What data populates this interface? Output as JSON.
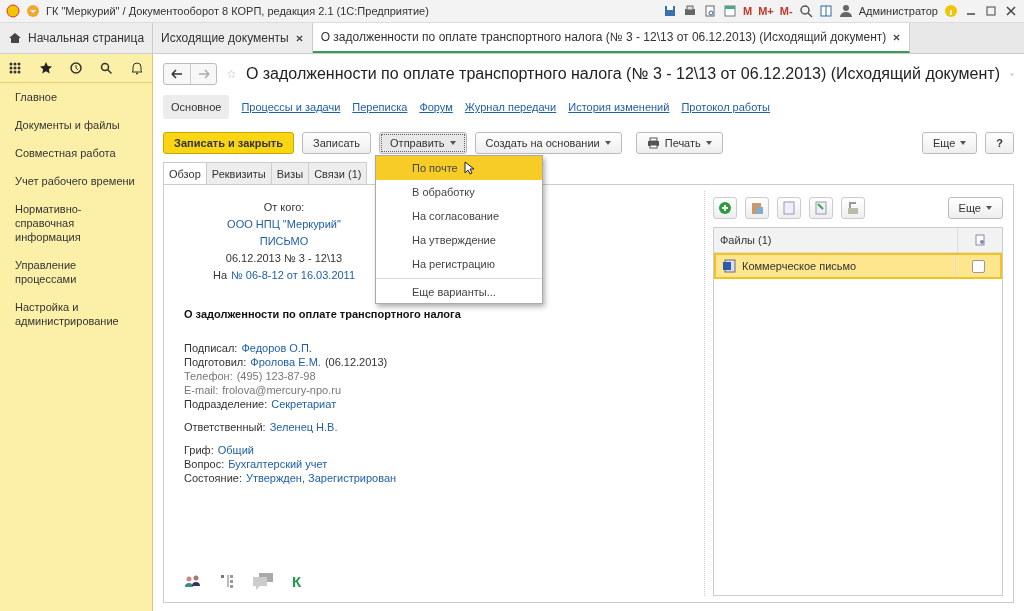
{
  "window": {
    "title": "ГК \"Меркурий\" / Документооборот 8 КОРП, редакция 2.1  (1С:Предприятие)",
    "user": "Администратор",
    "memory_buttons": [
      "M",
      "M+",
      "M-"
    ]
  },
  "tabs": [
    {
      "label": "Начальная страница",
      "selected": false,
      "closable": false
    },
    {
      "label": "Исходящие документы",
      "selected": false,
      "closable": true
    },
    {
      "label": "О задолженности по оплате транспортного налога (№ 3 - 12\\13 от 06.12.2013) (Исходящий документ)",
      "selected": true,
      "closable": true
    }
  ],
  "sidebar": {
    "items": [
      {
        "label": "Главное"
      },
      {
        "label": "Документы и файлы"
      },
      {
        "label": "Совместная работа"
      },
      {
        "label": "Учет рабочего времени"
      },
      {
        "label": "Нормативно-справочная информация"
      },
      {
        "label": "Управление процессами"
      },
      {
        "label": "Настройка и администрирование"
      }
    ]
  },
  "document": {
    "title": "О задолженности по оплате транспортного налога (№ 3 - 12\\13 от 06.12.2013) (Исходящий документ)",
    "nav_links": [
      {
        "label": "Основное",
        "selected": true
      },
      {
        "label": "Процессы и задачи",
        "selected": false
      },
      {
        "label": "Переписка",
        "selected": false
      },
      {
        "label": "Форум",
        "selected": false
      },
      {
        "label": "Журнал передачи",
        "selected": false
      },
      {
        "label": "История изменений",
        "selected": false
      },
      {
        "label": "Протокол работы",
        "selected": false
      }
    ],
    "buttons": [
      {
        "label": "Записать и закрыть",
        "kind": "primary"
      },
      {
        "label": "Записать",
        "kind": "plain"
      },
      {
        "label": "Отправить",
        "kind": "menu",
        "open": true
      },
      {
        "label": "Создать на основании",
        "kind": "menu",
        "open": false
      },
      {
        "label": "Печать",
        "kind": "print",
        "open": false
      }
    ],
    "more_button": "Еще",
    "help_button": "?",
    "send_menu": {
      "items": [
        {
          "label": "По почте",
          "selected": true
        },
        {
          "label": "В обработку",
          "selected": false
        },
        {
          "label": "На согласование",
          "selected": false
        },
        {
          "label": "На утверждение",
          "selected": false
        },
        {
          "label": "На регистрацию",
          "selected": false
        }
      ],
      "more": "Еще варианты..."
    },
    "subtabs": [
      {
        "label": "Обзор",
        "selected": true
      },
      {
        "label": "Реквизиты",
        "selected": false
      },
      {
        "label": "Визы",
        "selected": false
      },
      {
        "label": "Связи (1)",
        "selected": false
      }
    ],
    "overview": {
      "from_label": "От кого:",
      "organization": "ООО НПЦ \"Меркурий\"",
      "doc_type": "ПИСЬМО",
      "number_line": "06.12.2013 № 3 - 12\\13",
      "reply_prefix": "На",
      "reply_link": "№ 06-8-12 от 16.03.2011",
      "subject": "О задолженности по оплате транспортного налога",
      "field_groups": [
        [
          {
            "label": "Подписал:",
            "value": "Федоров О.П.",
            "kind": "link",
            "muted": false
          },
          {
            "label": "Подготовил:",
            "value": "Фролова Е.М.",
            "kind": "link",
            "muted": false,
            "note": "(06.12.2013)"
          },
          {
            "label": "Телефон:",
            "value": "(495) 123-87-98",
            "kind": "plain",
            "muted": true
          },
          {
            "label": "E-mail:",
            "value": "frolova@mercury-npo.ru",
            "kind": "plain",
            "muted": true
          },
          {
            "label": "Подразделение:",
            "value": "Секретариат",
            "kind": "link",
            "muted": false
          }
        ],
        [
          {
            "label": "Ответственный:",
            "value": "Зеленец Н.В.",
            "kind": "link",
            "muted": false
          }
        ],
        [
          {
            "label": "Гриф:",
            "value": "Общий",
            "kind": "link",
            "muted": false
          },
          {
            "label": "Вопрос:",
            "value": "Бухгалтерский учет",
            "kind": "link",
            "muted": false
          },
          {
            "label": "Состояние:",
            "value": "Утвержден, Зарегистрирован",
            "kind": "link",
            "muted": false
          }
        ]
      ],
      "footer_letter": "К"
    },
    "files": {
      "more_button": "Еще",
      "header": "Файлы (1)",
      "rows": [
        {
          "name": "Коммерческое письмо",
          "selected": true,
          "checked": false
        }
      ]
    }
  }
}
